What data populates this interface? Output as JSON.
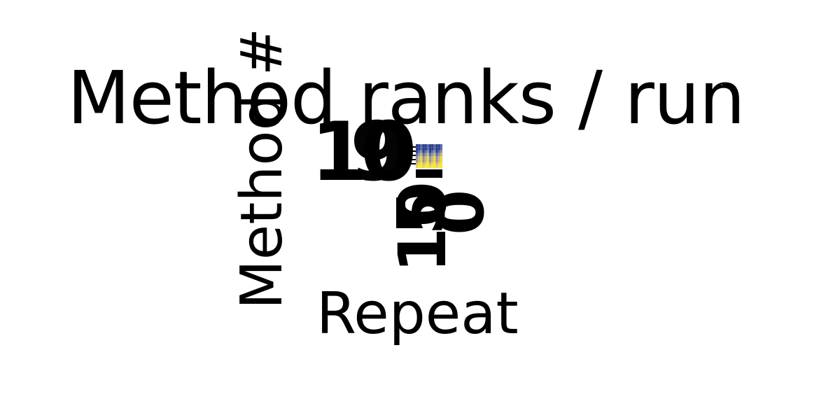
{
  "chart_data": {
    "type": "heatmap",
    "title": "Method ranks / run",
    "xlabel": "Repeat",
    "ylabel": "Method #",
    "y_tick_labels": [
      "10",
      "9"
    ],
    "x_tick_labels": [
      "10",
      "5",
      "0"
    ],
    "colorscale": [
      "#2f3f8e",
      "#5c6ea8",
      "#8b94a8",
      "#c8b878",
      "#efd54a",
      "#f7e640"
    ],
    "grid": false
  }
}
